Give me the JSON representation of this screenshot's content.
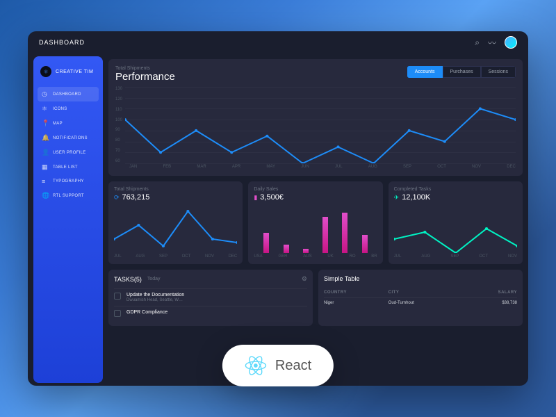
{
  "topbar": {
    "title": "DASHBOARD"
  },
  "sidebar": {
    "brand": "CREATIVE TIM",
    "items": [
      {
        "icon": "◷",
        "label": "DASHBOARD",
        "active": true
      },
      {
        "icon": "⚛",
        "label": "ICONS"
      },
      {
        "icon": "📍",
        "label": "MAP"
      },
      {
        "icon": "🔔",
        "label": "NOTIFICATIONS"
      },
      {
        "icon": "👤",
        "label": "USER PROFILE"
      },
      {
        "icon": "▦",
        "label": "TABLE LIST"
      },
      {
        "icon": "≡",
        "label": "TYPOGRAPHY"
      },
      {
        "icon": "🌐",
        "label": "RTL SUPPORT"
      }
    ]
  },
  "perf": {
    "subtitle": "Total Shipments",
    "title": "Performance",
    "tabs": [
      "Accounts",
      "Purchases",
      "Sessions"
    ]
  },
  "smallCards": [
    {
      "title": "Total Shipments",
      "icon": "⟳",
      "iconColor": "#1d8cf8",
      "value": "763,215"
    },
    {
      "title": "Daily Sales",
      "icon": "▮",
      "iconColor": "#e14eca",
      "value": "3,500€"
    },
    {
      "title": "Completed Tasks",
      "icon": "✈",
      "iconColor": "#00f2c3",
      "value": "12,100K"
    }
  ],
  "tasks": {
    "title": "TASKS(5)",
    "sub": "Today",
    "items": [
      {
        "t": "Update the Documentation",
        "d": "Dwuamish Head, Seattle, W…"
      },
      {
        "t": "GDPR Compliance",
        "d": ""
      }
    ]
  },
  "table": {
    "title": "Simple Table",
    "headers": [
      "COUNTRY",
      "CITY",
      "SALARY"
    ],
    "rows": [
      [
        "Niger",
        "Oud-Turnhout",
        "$38,738"
      ]
    ]
  },
  "pill": "React",
  "chart_data": [
    {
      "type": "line",
      "title": "Performance",
      "ylabel": "",
      "xlabel": "",
      "ylim": [
        60,
        130
      ],
      "categories": [
        "JAN",
        "FEB",
        "MAR",
        "APR",
        "MAY",
        "JUN",
        "JUL",
        "AUG",
        "SEP",
        "OCT",
        "NOV",
        "DEC"
      ],
      "values": [
        100,
        70,
        90,
        70,
        85,
        60,
        75,
        60,
        90,
        80,
        110,
        100
      ],
      "color": "#1d8cf8"
    },
    {
      "type": "line",
      "title": "Total Shipments",
      "ylim": [
        60,
        130
      ],
      "categories": [
        "JUL",
        "AUG",
        "SEP",
        "OCT",
        "NOV",
        "DEC"
      ],
      "values": [
        80,
        100,
        70,
        120,
        80,
        75
      ],
      "color": "#1d8cf8"
    },
    {
      "type": "bar",
      "title": "Daily Sales",
      "ylim": [
        0,
        120
      ],
      "categories": [
        "USA",
        "GER",
        "AUS",
        "UK",
        "RO",
        "BR"
      ],
      "values": [
        50,
        20,
        10,
        90,
        100,
        45
      ],
      "color": "#e14eca"
    },
    {
      "type": "line",
      "title": "Completed Tasks",
      "ylim": [
        60,
        130
      ],
      "categories": [
        "JUL",
        "AUG",
        "SEP",
        "OCT",
        "NOV"
      ],
      "values": [
        80,
        90,
        60,
        95,
        70
      ],
      "color": "#00f2c3"
    }
  ]
}
